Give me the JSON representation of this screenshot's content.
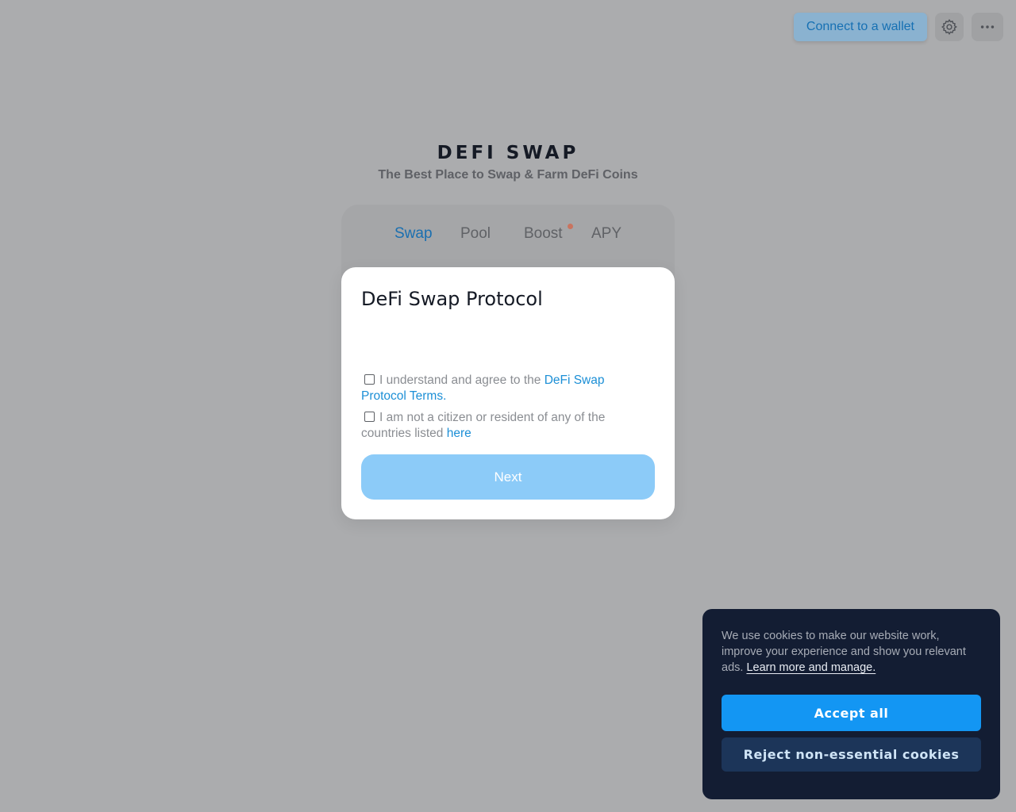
{
  "header": {
    "connect_label": "Connect to a wallet",
    "settings_icon": "gear-icon",
    "more_icon": "more-horizontal-icon"
  },
  "brand": {
    "title": "DEFI SWAP",
    "subtitle": "The Best Place to Swap & Farm DeFi Coins"
  },
  "tabs": [
    {
      "label": "Swap",
      "active": true
    },
    {
      "label": "Pool",
      "active": false
    },
    {
      "label": "Boost",
      "active": false,
      "badge_dot": true
    },
    {
      "label": "APY",
      "active": false
    }
  ],
  "modal": {
    "title": "DeFi Swap Protocol",
    "check1": {
      "text": "I understand and agree to the ",
      "link": "DeFi Swap Protocol Terms."
    },
    "check2": {
      "text": "I am not a citizen or resident of any of the countries listed ",
      "link": "here"
    },
    "next_label": "Next"
  },
  "cookie": {
    "text": "We use cookies to make our website work, improve your experience and show you relevant ads. ",
    "link": "Learn more and manage.",
    "accept_label": "Accept all",
    "reject_label": "Reject non-essential cookies"
  },
  "colors": {
    "overlay": "#abacae",
    "accent": "#1396f3",
    "link": "#1c8fd6",
    "cookie_bg": "#131d33"
  }
}
